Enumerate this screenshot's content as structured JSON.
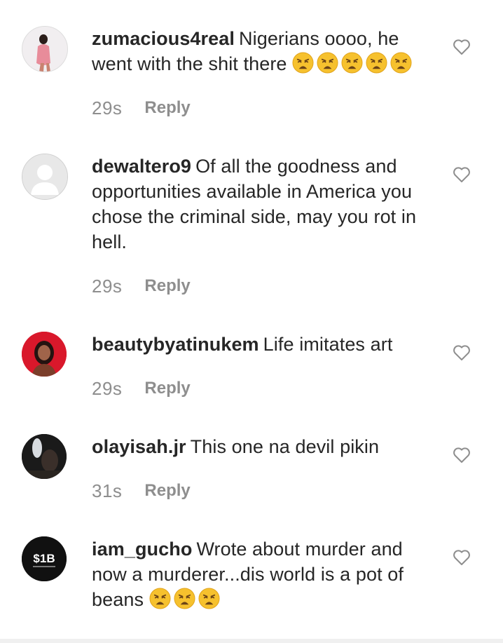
{
  "comments": [
    {
      "username": "zumacious4real",
      "text": "Nigerians oooo, he went with the shit there",
      "emoji_count": 5,
      "emoji": "weary-face-emoji",
      "time": "29s",
      "reply_label": "Reply",
      "avatar": "photo-avatar-pink"
    },
    {
      "username": "dewaltero9",
      "text": "Of all the goodness and opportunities available in America you chose the criminal side, may you rot in hell.",
      "emoji_count": 0,
      "time": "29s",
      "reply_label": "Reply",
      "avatar": "default-avatar"
    },
    {
      "username": "beautybyatinukem",
      "text": "Life imitates art",
      "emoji_count": 0,
      "time": "29s",
      "reply_label": "Reply",
      "avatar": "photo-avatar-red"
    },
    {
      "username": "olayisah.jr",
      "text": "This one na devil pikin",
      "emoji_count": 0,
      "time": "31s",
      "reply_label": "Reply",
      "avatar": "photo-avatar-dark"
    },
    {
      "username": "iam_gucho",
      "text": "Wrote about murder and now a murderer...dis world is a pot of beans",
      "emoji_count": 3,
      "emoji": "weary-face-emoji",
      "time": "",
      "reply_label": "",
      "avatar": "logo-avatar-1b",
      "avatar_text": "$1B"
    }
  ],
  "icons": {
    "like": "heart-outline-icon"
  },
  "colors": {
    "text": "#262626",
    "muted": "#8e8e8e",
    "emoji": "#f6c12e"
  }
}
